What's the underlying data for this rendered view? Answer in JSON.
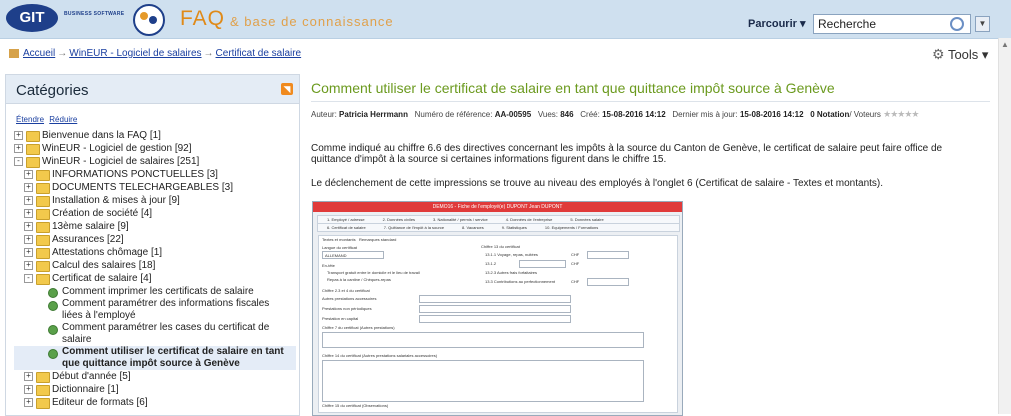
{
  "header": {
    "logo_text": "GIT",
    "business_text": "BUSINESS SOFTWARE",
    "faq_label": "FAQ",
    "faq_subtitle": "& base de connaissance",
    "browse_label": "Parcourir ▾",
    "search_value": "Recherche"
  },
  "breadcrumb": [
    "Accueil",
    "WinEUR - Logiciel de salaires",
    "Certificat de salaire"
  ],
  "tools_label": "Tools ▾",
  "sidebar": {
    "title": "Catégories",
    "expand_label": "Étendre",
    "collapse_label": "Réduire",
    "items": [
      {
        "label": "Bienvenue dans la FAQ [1]",
        "level": 0,
        "state": "+"
      },
      {
        "label": "WinEUR - Logiciel de gestion [92]",
        "level": 0,
        "state": "+"
      },
      {
        "label": "WinEUR - Logiciel de salaires [251]",
        "level": 0,
        "state": "-"
      },
      {
        "label": "INFORMATIONS PONCTUELLES [3]",
        "level": 1,
        "state": "+"
      },
      {
        "label": "DOCUMENTS TELECHARGEABLES [3]",
        "level": 1,
        "state": "+"
      },
      {
        "label": "Installation & mises à jour [9]",
        "level": 1,
        "state": "+"
      },
      {
        "label": "Création de société [4]",
        "level": 1,
        "state": "+"
      },
      {
        "label": "13ème salaire [9]",
        "level": 1,
        "state": "+"
      },
      {
        "label": "Assurances [22]",
        "level": 1,
        "state": "+"
      },
      {
        "label": "Attestations chômage [1]",
        "level": 1,
        "state": "+"
      },
      {
        "label": "Calcul des salaires [18]",
        "level": 1,
        "state": "+"
      },
      {
        "label": "Certificat de salaire [4]",
        "level": 1,
        "state": "-"
      },
      {
        "label": "Comment imprimer les certificats de salaire",
        "level": 2,
        "state": "article"
      },
      {
        "label": "Comment paramétrer des informations fiscales liées à l'employé",
        "level": 2,
        "state": "article"
      },
      {
        "label": "Comment paramétrer les cases du certificat de salaire",
        "level": 2,
        "state": "article"
      },
      {
        "label": "Comment utiliser le certificat de salaire en tant que quittance impôt source à Genève",
        "level": 2,
        "state": "article-active"
      },
      {
        "label": "Début d'année [5]",
        "level": 1,
        "state": "+"
      },
      {
        "label": "Dictionnaire [1]",
        "level": 1,
        "state": "+"
      },
      {
        "label": "Editeur de formats [6]",
        "level": 1,
        "state": "+"
      }
    ]
  },
  "article": {
    "title": "Comment utiliser le certificat de salaire en tant que quittance impôt source à Genève",
    "meta": {
      "author_label": "Auteur:",
      "author": "Patricia Herrmann",
      "ref_label": "Numéro de référence:",
      "ref": "AA-00595",
      "views_label": "Vues:",
      "views": "846",
      "created_label": "Créé:",
      "created": "15-08-2016 14:12",
      "updated_label": "Dernier mis à jour:",
      "updated": "15-08-2016 14:12",
      "rating": "0 Notation",
      "voters_label": "/ Voteurs"
    },
    "para1": "Comme indiqué au chiffre 6.6 des directives concernant les impôts à la source du Canton de Genève, le certificat de salaire peut faire office de quittance d'impôt à la source si certaines informations figurent dans le chiffre 15.",
    "para2": "Le déclenchement de cette impressions se trouve au niveau des employés à l'onglet 6 (Certificat de salaire - Textes et montants)."
  },
  "embedded": {
    "title": "DEMO16 - Fiche de l'employé(e) DUPONT Jean DUPONT",
    "tabs_row1": [
      "1. Employé / adresse",
      "2. Données civiles",
      "3. Nationalité / permis / service",
      "4. Données de l'entreprise",
      "5. Données salaire"
    ],
    "tabs_row2": [
      "6. Certificat de salaire",
      "7. Quittance de l'impôt à la source",
      "8. Vacances",
      "9. Statistiques",
      "10. Equipements / Formations"
    ],
    "subtabs": [
      "Textes et montants",
      "Remarques standard"
    ],
    "lang_label": "Langue du certificat",
    "lang_value": "ALLEMAND",
    "entete_label": "En-tête",
    "chk1": "Transport gratuit entre le domicile et le lieu de travail",
    "chk2": "Repas à la cantine / Chèques-repas",
    "ch13_label": "Chiffre 13 du certificat",
    "ch13_1": "13.1.1 Voyage, repas, nuitées",
    "ch13_12": "13.1.2",
    "ch13_23": "13.2.3 Autres frais forfaitaires",
    "ch13_3": "13.3 Contributions au perfectionnement",
    "chf": "CHF",
    "ch234_label": "Chiffre 2.3 et 4 du certificat",
    "prest_acc": "Autres prestations accessoires",
    "prest_nonper": "Prestations non périodiques",
    "prest_cap": "Prestation en capital",
    "ch7_label": "Chiffre 7 du certificat (Autres prestations)",
    "ch14_label": "Chiffre 14 du certificat (Autres prestations salariales accessoires)",
    "ch15_label": "Chiffre 15 du certificat (Observations)"
  }
}
